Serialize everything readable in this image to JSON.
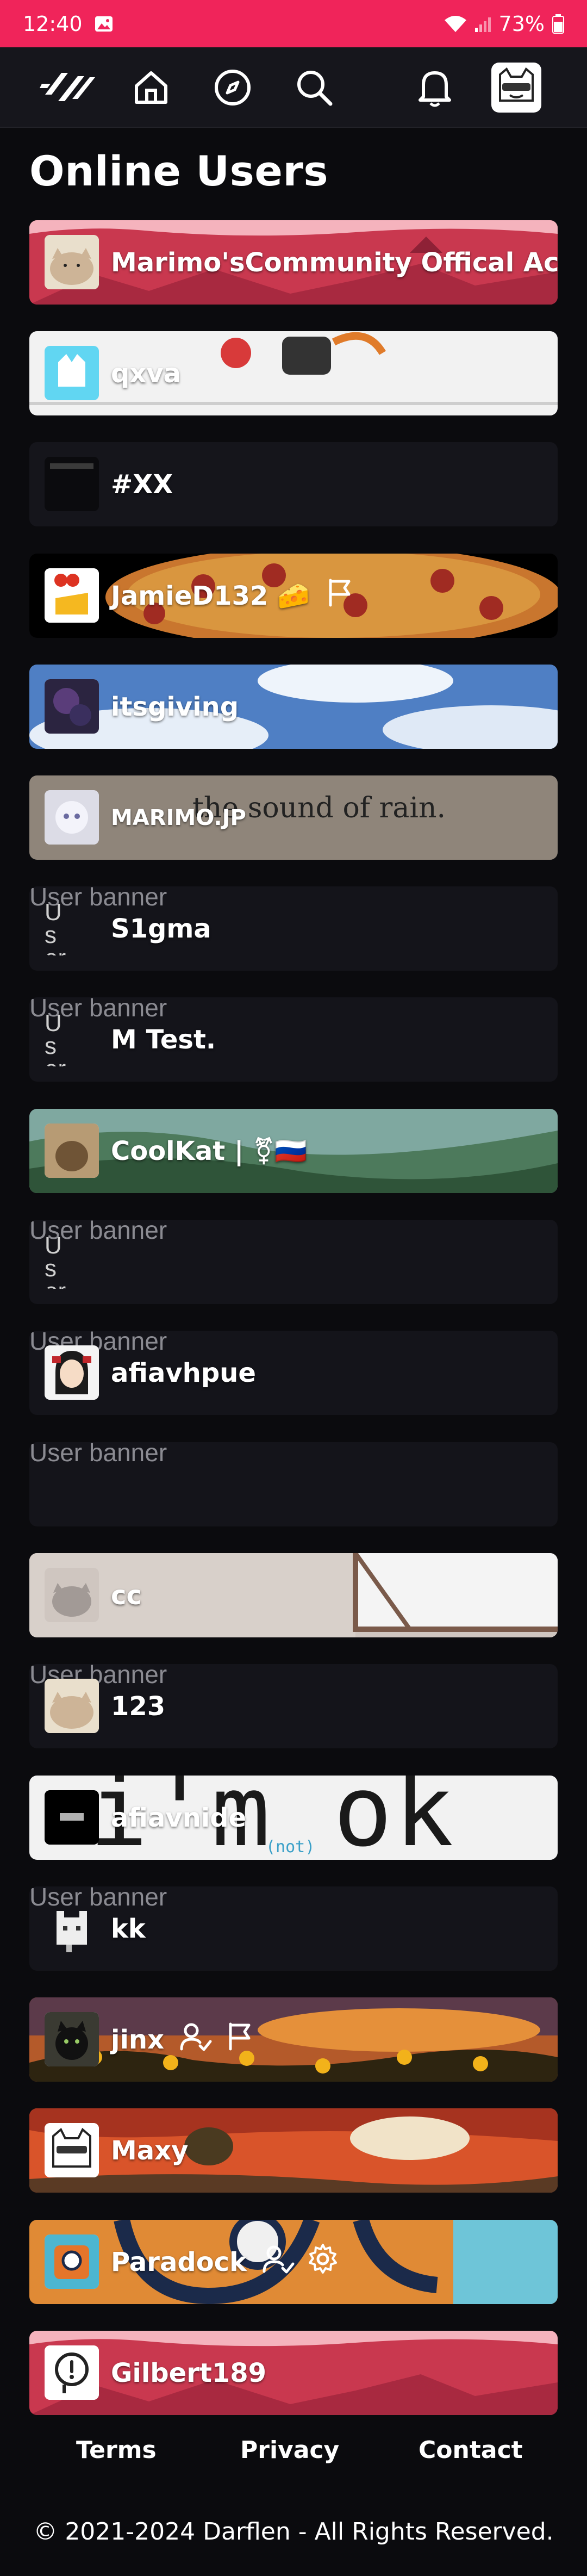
{
  "status_bar": {
    "time": "12:40",
    "battery": "73%"
  },
  "nav": {
    "items": [
      "logo-icon",
      "home-icon",
      "compass-icon",
      "search-icon",
      "bell-icon",
      "avatar-icon"
    ]
  },
  "page": {
    "title": "Online Users"
  },
  "users": [
    {
      "name": "Marimo'sCommunity Offical Acc",
      "banner_alt": ""
    },
    {
      "name": "qxva",
      "banner_alt": ""
    },
    {
      "name": "#XX",
      "banner_alt": ""
    },
    {
      "name": "JamieD132 🧀",
      "banner_alt": ""
    },
    {
      "name": "itsgiving",
      "banner_alt": ""
    },
    {
      "name": "MARIMO.JP",
      "banner_alt": "",
      "banner_text": "the sound of rain."
    },
    {
      "name": "S1gma",
      "banner_alt": "User banner",
      "avatar_alt": "User"
    },
    {
      "name": "M Test.",
      "banner_alt": "User banner",
      "avatar_alt": "User"
    },
    {
      "name": "CoolKat | ⚧🇷🇺",
      "banner_alt": ""
    },
    {
      "name": "",
      "banner_alt": "User banner",
      "avatar_alt": "User"
    },
    {
      "name": "afiavhpue",
      "banner_alt": "User banner"
    },
    {
      "name": "",
      "banner_alt": "User banner"
    },
    {
      "name": "cc",
      "banner_alt": ""
    },
    {
      "name": "123",
      "banner_alt": "User banner"
    },
    {
      "name": "afiavnide",
      "banner_alt": "",
      "banner_text": "i'm ok",
      "banner_subtext": "(not)"
    },
    {
      "name": "kk",
      "banner_alt": "User banner"
    },
    {
      "name": "jinx",
      "banner_alt": ""
    },
    {
      "name": "Maxy",
      "banner_alt": ""
    },
    {
      "name": "Paradock",
      "banner_alt": ""
    },
    {
      "name": "Gilbert189",
      "banner_alt": ""
    }
  ],
  "footer": {
    "links": [
      "Terms",
      "Privacy",
      "Contact"
    ],
    "copyright": "© 2021-2024 Darflen - All Rights Reserved."
  }
}
